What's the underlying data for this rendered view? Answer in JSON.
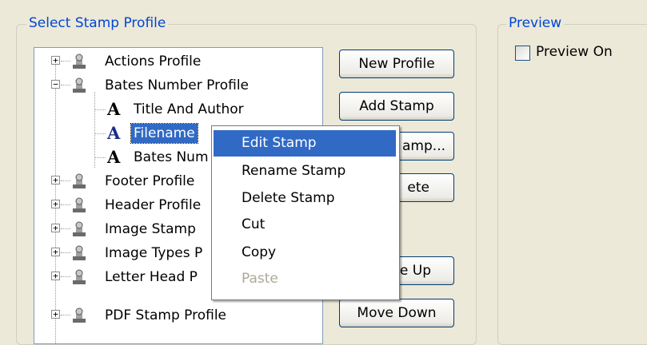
{
  "stamp_profile": {
    "title": "Select Stamp Profile",
    "tree": [
      {
        "label": "Actions Profile",
        "expander": "+"
      },
      {
        "label": "Bates Number Profile",
        "expander": "−"
      },
      {
        "label": "Title And Author"
      },
      {
        "label": "Filename",
        "selected": true
      },
      {
        "label": "Bates Num"
      },
      {
        "label": "Footer Profile",
        "expander": "+"
      },
      {
        "label": "Header Profile",
        "expander": "+"
      },
      {
        "label": "Image Stamp",
        "expander": "+"
      },
      {
        "label": "Image Types P",
        "expander": "+"
      },
      {
        "label": "Letter Head P",
        "expander": "+"
      },
      {
        "label": "PDF Stamp Profile",
        "expander": "+"
      }
    ],
    "buttons": {
      "new_profile": "New Profile",
      "add_stamp": "Add Stamp",
      "edit_stamp": "amp...",
      "delete": "ete",
      "move_up": "e Up",
      "move_down": "Move Down"
    }
  },
  "context_menu": {
    "items": [
      {
        "label": "Edit Stamp",
        "state": "highlighted"
      },
      {
        "label": "Rename Stamp",
        "state": "enabled"
      },
      {
        "label": "Delete Stamp",
        "state": "enabled"
      },
      {
        "label": "Cut",
        "state": "enabled"
      },
      {
        "label": "Copy",
        "state": "enabled"
      },
      {
        "label": "Paste",
        "state": "disabled"
      }
    ]
  },
  "preview": {
    "title": "Preview",
    "checkbox_label": "Preview On",
    "checked": false
  },
  "colors": {
    "window_bg": "#ece9d8",
    "group_title": "#0046d5",
    "selection": "#316ac5",
    "disabled_text": "#aca899"
  }
}
